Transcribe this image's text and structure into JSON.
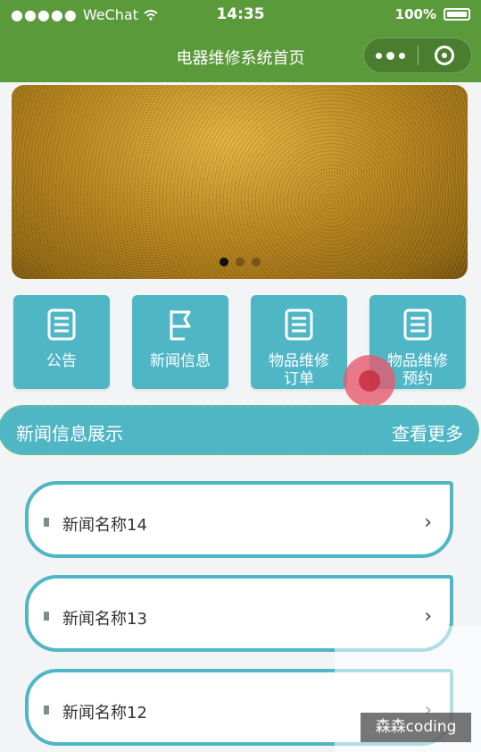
{
  "status_bar": {
    "carrier": "WeChat",
    "time": "14:35",
    "battery": "100%"
  },
  "nav": {
    "title": "电器维修系统首页"
  },
  "banner": {
    "indicator_count": 3,
    "active_index": 0
  },
  "menu": [
    {
      "label": "公告",
      "icon": "document-icon"
    },
    {
      "label": "新闻信息",
      "icon": "flag-icon"
    },
    {
      "label": "物品维修订单",
      "icon": "document-icon"
    },
    {
      "label": "物品维修预约",
      "icon": "document-icon"
    }
  ],
  "section": {
    "title": "新闻信息展示",
    "more": "查看更多"
  },
  "news": [
    {
      "title": "新闻名称14"
    },
    {
      "title": "新闻名称13"
    },
    {
      "title": "新闻名称12"
    }
  ],
  "watermark": {
    "text": "森森coding"
  },
  "colors": {
    "primary": "#5b9a3a",
    "accent": "#4fb6c6",
    "tap": "#e65a6e"
  }
}
